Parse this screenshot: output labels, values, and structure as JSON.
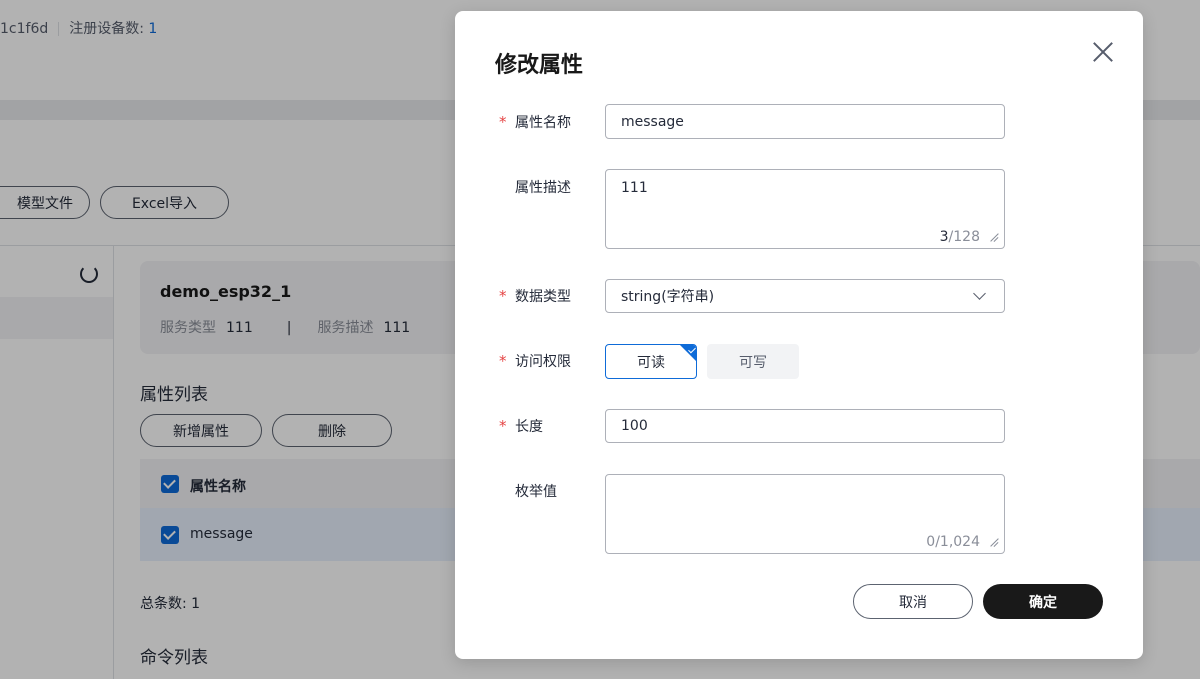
{
  "background": {
    "top_bar": {
      "id_fragment": "1c1f6d",
      "registered_label": "注册设备数:",
      "registered_count": "1"
    },
    "toolbar": {
      "model_file_button": "模型文件",
      "excel_import_button": "Excel导入"
    },
    "service": {
      "name": "demo_esp32_1",
      "type_label": "服务类型",
      "type_value": "111",
      "divider": "|",
      "desc_label": "服务描述",
      "desc_value": "111"
    },
    "property_list": {
      "title": "属性列表",
      "add_button": "新增属性",
      "delete_button": "删除",
      "column_header": "属性名称",
      "rows": [
        "message"
      ],
      "total_label": "总条数:",
      "total_value": "1"
    },
    "command_list": {
      "title": "命令列表"
    }
  },
  "modal": {
    "title": "修改属性",
    "fields": {
      "name": {
        "label": "属性名称",
        "required": "*",
        "value": "message"
      },
      "description": {
        "label": "属性描述",
        "value": "111",
        "count_current": "3",
        "count_max": "/128"
      },
      "data_type": {
        "label": "数据类型",
        "required": "*",
        "value": "string(字符串)"
      },
      "access": {
        "label": "访问权限",
        "required": "*",
        "options": [
          "可读",
          "可写"
        ],
        "selected": "可读"
      },
      "length": {
        "label": "长度",
        "required": "*",
        "value": "100"
      },
      "enum": {
        "label": "枚举值",
        "value": "",
        "count": "0/1,024"
      }
    },
    "buttons": {
      "cancel": "取消",
      "confirm": "确定"
    }
  },
  "colors": {
    "accent": "#0e6bd8",
    "required": "#e54545",
    "primary_button": "#191919"
  }
}
